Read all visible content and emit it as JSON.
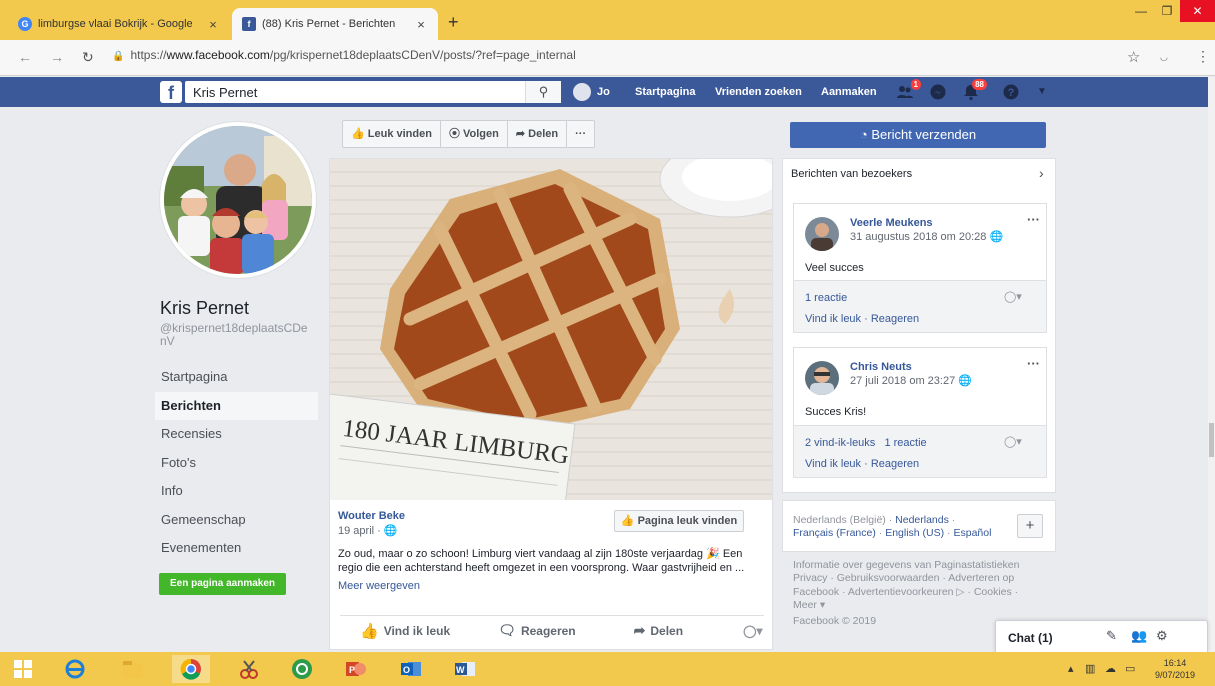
{
  "browser": {
    "tabs": [
      {
        "title": "limburgse vlaai Bokrijk - Google",
        "favicon": "google-icon"
      },
      {
        "title": "(88) Kris Pernet - Berichten",
        "favicon": "facebook-icon"
      }
    ],
    "url_prefix": "https://",
    "url_host": "www.facebook.com",
    "url_path": "/pg/krispernet18deplaatsCDenV/posts/?ref=page_internal"
  },
  "fb_header": {
    "search_value": "Kris Pernet",
    "user": "Jo",
    "nav": [
      "Startpagina",
      "Vrienden zoeken",
      "Aanmaken"
    ],
    "badges": {
      "friends": "1",
      "notifications": "88"
    }
  },
  "page": {
    "name": "Kris Pernet",
    "handle": "@krispernet18deplaatsCDenV",
    "sidenav": [
      "Startpagina",
      "Berichten",
      "Recensies",
      "Foto's",
      "Info",
      "Gemeenschap",
      "Evenementen"
    ],
    "active_nav": "Berichten",
    "create_button": "Een pagina aanmaken"
  },
  "action_bar": {
    "like": "Leuk vinden",
    "follow": "Volgen",
    "share": "Delen",
    "more": "···"
  },
  "post": {
    "photo_caption": "180 JAAR LIMBURG",
    "author": "Wouter Beke",
    "date": "19 april ·",
    "like_page_button": "Pagina leuk vinden",
    "text": "Zo oud, maar o zo schoon! Limburg viert vandaag al zijn 180ste verjaardag 🎉 Een regio die een achterstand heeft omgezet in een voorsprong. Waar gastvrijheid en ...",
    "more": "Meer weergeven",
    "actions": {
      "like": "Vind ik leuk",
      "comment": "Reageren",
      "share": "Delen"
    }
  },
  "right": {
    "send_message": "Bericht verzenden",
    "visitors_title": "Berichten van bezoekers",
    "visitor_posts": [
      {
        "name": "Veerle Meukens",
        "date": "31 augustus 2018 om 20:28",
        "text": "Veel succes",
        "stats": "1 reactie",
        "actions": "Vind ik leuk · Reageren"
      },
      {
        "name": "Chris Neuts",
        "date": "27 juli 2018 om 23:27",
        "text": "Succes Kris!",
        "stats": "2 vind-ik-leuks   1 reactie",
        "actions": "Vind ik leuk · Reageren"
      }
    ],
    "languages": {
      "current": "Nederlands (België)",
      "sep": " · ",
      "links": [
        "Nederlands",
        "Français (France)",
        "English (US)",
        "Español"
      ]
    },
    "footer_links": "Informatie over gegevens van Paginastatistieken Privacy · Gebruiksvoorwaarden · Adverteren op Facebook · Advertentievoorkeuren ▷ · Cookies · Meer ▾",
    "copyright": "Facebook © 2019",
    "chat_label": "Chat (1)"
  },
  "taskbar": {
    "time": "16:14",
    "date": "9/07/2019"
  },
  "colors": {
    "fb_blue": "#3b5998",
    "button_blue": "#4267b2",
    "link": "#365899",
    "green": "#42b72a",
    "chrome_yellow": "#f2c94c"
  }
}
